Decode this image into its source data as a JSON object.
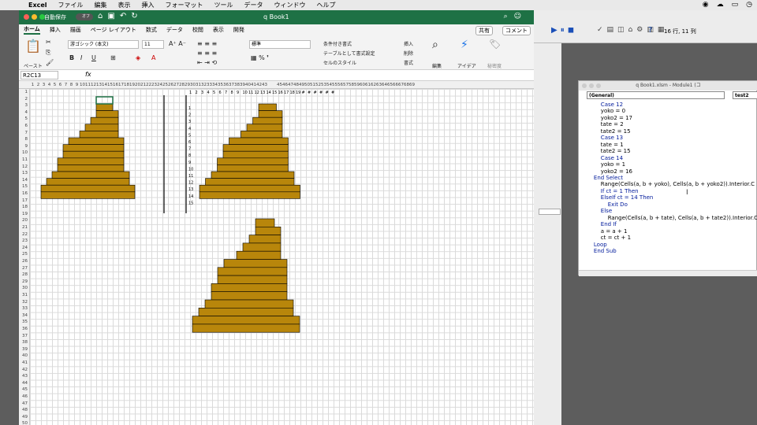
{
  "menubar": {
    "app": "Excel",
    "items": [
      "ファイル",
      "編集",
      "表示",
      "挿入",
      "フォーマット",
      "ツール",
      "データ",
      "ウィンドウ",
      "ヘルプ"
    ]
  },
  "excel": {
    "autosave": "自動保存",
    "toggle": "オフ",
    "workbook": "q Book1",
    "tabs": [
      "ホーム",
      "挿入",
      "描画",
      "ページ レイアウト",
      "数式",
      "データ",
      "校閲",
      "表示",
      "開発"
    ],
    "share": "共有",
    "comment": "コメント",
    "ribbon": {
      "paste": "ペースト",
      "font": "游ゴシック (本文)",
      "size": "11",
      "number_format": "標準",
      "cond": "条件付き書式",
      "table": "テーブルとして書式設定",
      "cellstyle": "セルのスタイル",
      "insert": "挿入",
      "delete": "削除",
      "format": "書式",
      "edit": "編集",
      "ideas": "アイデア",
      "sensitivity": "秘密度"
    },
    "namebox": "R2C13",
    "fx": "fx"
  },
  "sheet": {
    "col_headers": [
      "1",
      "2",
      "3",
      "4",
      "5",
      "6",
      "7",
      "8",
      "9",
      "10",
      "11",
      "12",
      "13",
      "14",
      "15",
      "16",
      "17",
      "18",
      "19",
      "20",
      "21",
      "22",
      "23",
      "24",
      "25",
      "26",
      "27",
      "28",
      "29",
      "30",
      "31",
      "32",
      "33",
      "34",
      "35",
      "36",
      "37",
      "38",
      "39",
      "40",
      "41",
      "42",
      "43",
      "45",
      "46",
      "47",
      "48",
      "49",
      "50",
      "51",
      "52",
      "53",
      "54",
      "55",
      "56",
      "57",
      "58",
      "59",
      "60",
      "61",
      "62",
      "63",
      "64",
      "65",
      "66",
      "67",
      "68",
      "69"
    ],
    "row_headers": [
      "1",
      "2",
      "3",
      "4",
      "5",
      "6",
      "7",
      "8",
      "9",
      "10",
      "11",
      "12",
      "13",
      "14",
      "15",
      "16",
      "17",
      "18",
      "19",
      "20",
      "21",
      "22",
      "23",
      "24",
      "25",
      "26",
      "27",
      "28",
      "29",
      "30",
      "31",
      "32",
      "33",
      "34",
      "35",
      "36",
      "37",
      "38",
      "39",
      "40",
      "41",
      "42",
      "43",
      "44",
      "45",
      "46",
      "47",
      "48",
      "49",
      "50"
    ],
    "fill_color": "#b8860b",
    "outline_color": "#000000",
    "mini_cols": [
      "1",
      "2",
      "3",
      "4",
      "5",
      "6",
      "7",
      "8",
      "9",
      "10",
      "11",
      "12",
      "13",
      "14",
      "15",
      "16",
      "17",
      "18",
      "19",
      "#",
      "#",
      "#",
      "#",
      "#",
      "#"
    ],
    "mini_rows": [
      "1",
      "2",
      "3",
      "4",
      "5",
      "6",
      "7",
      "8",
      "9",
      "10",
      "11",
      "12",
      "13",
      "14",
      "15"
    ]
  },
  "vbe": {
    "status": "16 行, 11 列",
    "title": "q Book1.xlsm - Module1 (コ",
    "combo_left": "(General)",
    "combo_right": "test2",
    "code": [
      "        Case 12",
      "        yoko = 0",
      "        yoko2 = 17",
      "        tate = 2",
      "        tate2 = 15",
      "        Case 13",
      "        tate = 1",
      "        tate2 = 15",
      "        Case 14",
      "        yoko = 1",
      "        yoko2 = 16",
      "    End Select",
      "        Range(Cells(a, b + yoko), Cells(a, b + yoko2)).Interior.C",
      "        If ct = 1 Then",
      "        ElseIf ct = 14 Then",
      "            Exit Do",
      "        Else",
      "            Range(Cells(a, b + tate), Cells(a, b + tate2)).Interior.C",
      "        End If",
      "        a = a + 1",
      "        ct = ct + 1",
      "    Loop",
      "    End Sub"
    ]
  }
}
